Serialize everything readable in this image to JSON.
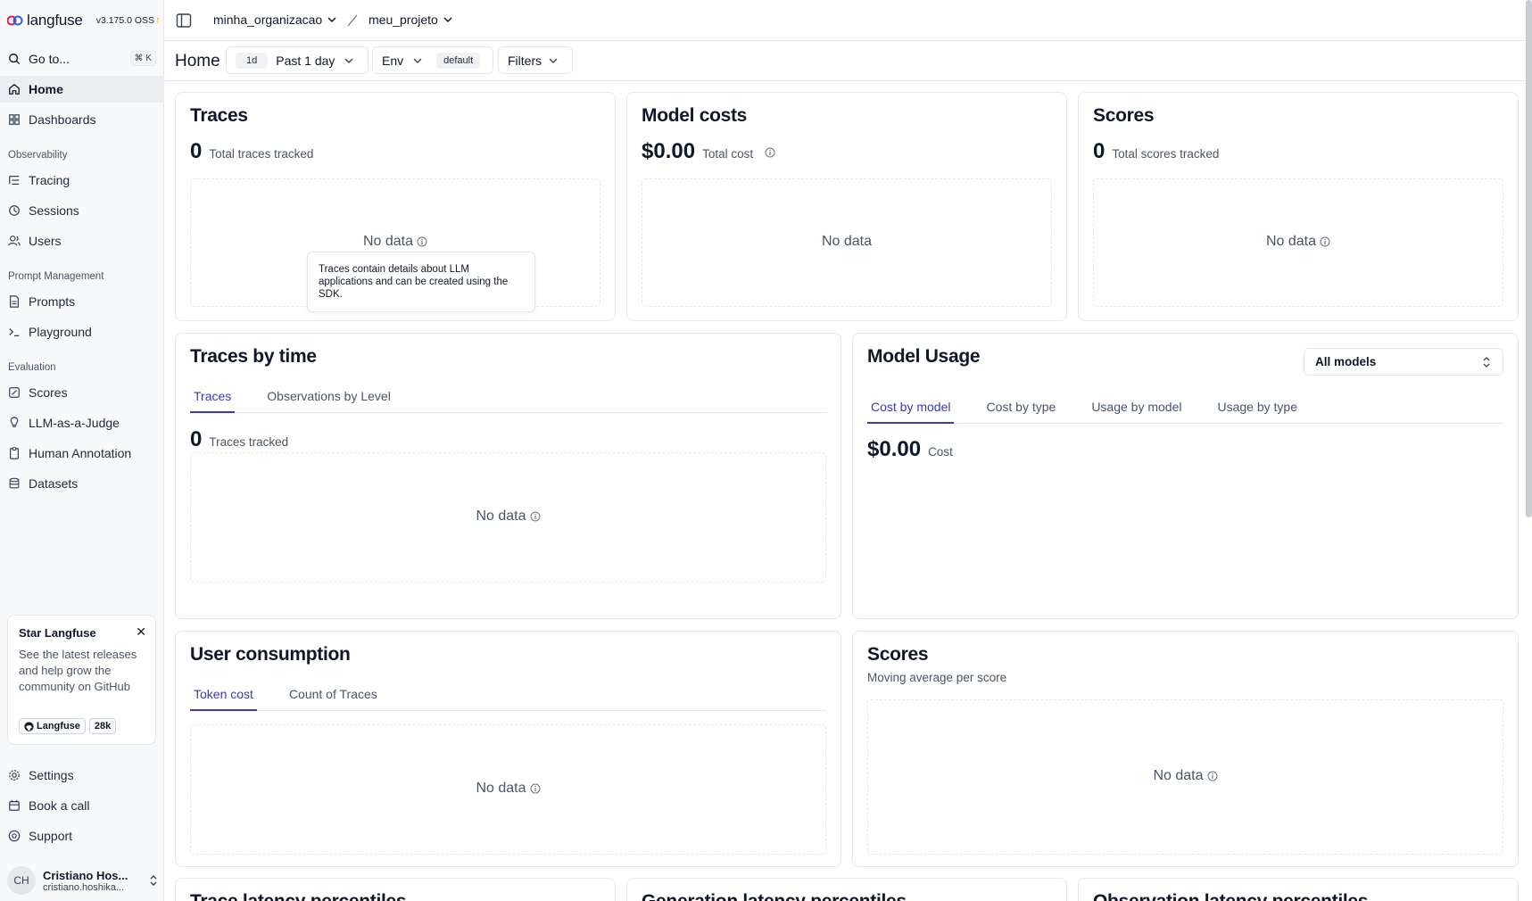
{
  "app": {
    "name": "langfuse",
    "version": "v3.175.0 OSS"
  },
  "sidebar": {
    "goto_label": "Go to...",
    "goto_shortcut": "⌘ K",
    "items": {
      "home": "Home",
      "dashboards": "Dashboards",
      "tracing": "Tracing",
      "sessions": "Sessions",
      "users": "Users",
      "prompts": "Prompts",
      "playground": "Playground",
      "scores": "Scores",
      "llm_judge": "LLM-as-a-Judge",
      "human_annotation": "Human Annotation",
      "datasets": "Datasets",
      "settings": "Settings",
      "book_call": "Book a call",
      "support": "Support"
    },
    "sections": {
      "observability": "Observability",
      "prompt_management": "Prompt Management",
      "evaluation": "Evaluation"
    },
    "star_card": {
      "title": "Star Langfuse",
      "description": "See the latest releases and help grow the community on GitHub",
      "repo_label": "Langfuse",
      "stars": "28k"
    },
    "user": {
      "initials": "CH",
      "name": "Cristiano Hos...",
      "email": "cristiano.hoshika..."
    }
  },
  "topbar": {
    "organization": "minha_organizacao",
    "project": "meu_projeto"
  },
  "header": {
    "title": "Home",
    "range_chip": "1d",
    "range_label": "Past 1 day",
    "env_label": "Env",
    "env_value": "default",
    "filters_label": "Filters"
  },
  "cards": {
    "traces": {
      "title": "Traces",
      "value": "0",
      "label": "Total traces tracked",
      "nodata": "No data",
      "tooltip": "Traces contain details about LLM applications and can be created using the SDK."
    },
    "model_costs": {
      "title": "Model costs",
      "value": "$0.00",
      "label": "Total cost",
      "nodata": "No data"
    },
    "scores": {
      "title": "Scores",
      "value": "0",
      "label": "Total scores tracked",
      "nodata": "No data"
    },
    "traces_by_time": {
      "title": "Traces by time",
      "tabs": [
        "Traces",
        "Observations by Level"
      ],
      "value": "0",
      "label": "Traces tracked",
      "nodata": "No data"
    },
    "model_usage": {
      "title": "Model Usage",
      "select": "All models",
      "tabs": [
        "Cost by model",
        "Cost by type",
        "Usage by model",
        "Usage by type"
      ],
      "value": "$0.00",
      "label": "Cost"
    },
    "user_consumption": {
      "title": "User consumption",
      "tabs": [
        "Token cost",
        "Count of Traces"
      ],
      "nodata": "No data"
    },
    "scores_avg": {
      "title": "Scores",
      "subtitle": "Moving average per score",
      "nodata": "No data"
    },
    "bottom": [
      "Trace latency percentiles",
      "Generation latency percentiles",
      "Observation latency percentiles"
    ]
  }
}
